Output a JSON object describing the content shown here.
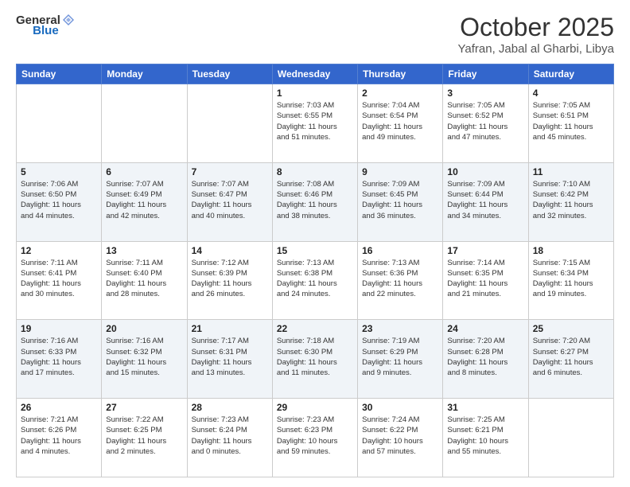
{
  "header": {
    "logo_general": "General",
    "logo_blue": "Blue",
    "month_title": "October 2025",
    "location": "Yafran, Jabal al Gharbi, Libya"
  },
  "weekdays": [
    "Sunday",
    "Monday",
    "Tuesday",
    "Wednesday",
    "Thursday",
    "Friday",
    "Saturday"
  ],
  "weeks": [
    [
      {
        "day": "",
        "info": ""
      },
      {
        "day": "",
        "info": ""
      },
      {
        "day": "",
        "info": ""
      },
      {
        "day": "1",
        "info": "Sunrise: 7:03 AM\nSunset: 6:55 PM\nDaylight: 11 hours\nand 51 minutes."
      },
      {
        "day": "2",
        "info": "Sunrise: 7:04 AM\nSunset: 6:54 PM\nDaylight: 11 hours\nand 49 minutes."
      },
      {
        "day": "3",
        "info": "Sunrise: 7:05 AM\nSunset: 6:52 PM\nDaylight: 11 hours\nand 47 minutes."
      },
      {
        "day": "4",
        "info": "Sunrise: 7:05 AM\nSunset: 6:51 PM\nDaylight: 11 hours\nand 45 minutes."
      }
    ],
    [
      {
        "day": "5",
        "info": "Sunrise: 7:06 AM\nSunset: 6:50 PM\nDaylight: 11 hours\nand 44 minutes."
      },
      {
        "day": "6",
        "info": "Sunrise: 7:07 AM\nSunset: 6:49 PM\nDaylight: 11 hours\nand 42 minutes."
      },
      {
        "day": "7",
        "info": "Sunrise: 7:07 AM\nSunset: 6:47 PM\nDaylight: 11 hours\nand 40 minutes."
      },
      {
        "day": "8",
        "info": "Sunrise: 7:08 AM\nSunset: 6:46 PM\nDaylight: 11 hours\nand 38 minutes."
      },
      {
        "day": "9",
        "info": "Sunrise: 7:09 AM\nSunset: 6:45 PM\nDaylight: 11 hours\nand 36 minutes."
      },
      {
        "day": "10",
        "info": "Sunrise: 7:09 AM\nSunset: 6:44 PM\nDaylight: 11 hours\nand 34 minutes."
      },
      {
        "day": "11",
        "info": "Sunrise: 7:10 AM\nSunset: 6:42 PM\nDaylight: 11 hours\nand 32 minutes."
      }
    ],
    [
      {
        "day": "12",
        "info": "Sunrise: 7:11 AM\nSunset: 6:41 PM\nDaylight: 11 hours\nand 30 minutes."
      },
      {
        "day": "13",
        "info": "Sunrise: 7:11 AM\nSunset: 6:40 PM\nDaylight: 11 hours\nand 28 minutes."
      },
      {
        "day": "14",
        "info": "Sunrise: 7:12 AM\nSunset: 6:39 PM\nDaylight: 11 hours\nand 26 minutes."
      },
      {
        "day": "15",
        "info": "Sunrise: 7:13 AM\nSunset: 6:38 PM\nDaylight: 11 hours\nand 24 minutes."
      },
      {
        "day": "16",
        "info": "Sunrise: 7:13 AM\nSunset: 6:36 PM\nDaylight: 11 hours\nand 22 minutes."
      },
      {
        "day": "17",
        "info": "Sunrise: 7:14 AM\nSunset: 6:35 PM\nDaylight: 11 hours\nand 21 minutes."
      },
      {
        "day": "18",
        "info": "Sunrise: 7:15 AM\nSunset: 6:34 PM\nDaylight: 11 hours\nand 19 minutes."
      }
    ],
    [
      {
        "day": "19",
        "info": "Sunrise: 7:16 AM\nSunset: 6:33 PM\nDaylight: 11 hours\nand 17 minutes."
      },
      {
        "day": "20",
        "info": "Sunrise: 7:16 AM\nSunset: 6:32 PM\nDaylight: 11 hours\nand 15 minutes."
      },
      {
        "day": "21",
        "info": "Sunrise: 7:17 AM\nSunset: 6:31 PM\nDaylight: 11 hours\nand 13 minutes."
      },
      {
        "day": "22",
        "info": "Sunrise: 7:18 AM\nSunset: 6:30 PM\nDaylight: 11 hours\nand 11 minutes."
      },
      {
        "day": "23",
        "info": "Sunrise: 7:19 AM\nSunset: 6:29 PM\nDaylight: 11 hours\nand 9 minutes."
      },
      {
        "day": "24",
        "info": "Sunrise: 7:20 AM\nSunset: 6:28 PM\nDaylight: 11 hours\nand 8 minutes."
      },
      {
        "day": "25",
        "info": "Sunrise: 7:20 AM\nSunset: 6:27 PM\nDaylight: 11 hours\nand 6 minutes."
      }
    ],
    [
      {
        "day": "26",
        "info": "Sunrise: 7:21 AM\nSunset: 6:26 PM\nDaylight: 11 hours\nand 4 minutes."
      },
      {
        "day": "27",
        "info": "Sunrise: 7:22 AM\nSunset: 6:25 PM\nDaylight: 11 hours\nand 2 minutes."
      },
      {
        "day": "28",
        "info": "Sunrise: 7:23 AM\nSunset: 6:24 PM\nDaylight: 11 hours\nand 0 minutes."
      },
      {
        "day": "29",
        "info": "Sunrise: 7:23 AM\nSunset: 6:23 PM\nDaylight: 10 hours\nand 59 minutes."
      },
      {
        "day": "30",
        "info": "Sunrise: 7:24 AM\nSunset: 6:22 PM\nDaylight: 10 hours\nand 57 minutes."
      },
      {
        "day": "31",
        "info": "Sunrise: 7:25 AM\nSunset: 6:21 PM\nDaylight: 10 hours\nand 55 minutes."
      },
      {
        "day": "",
        "info": ""
      }
    ]
  ]
}
